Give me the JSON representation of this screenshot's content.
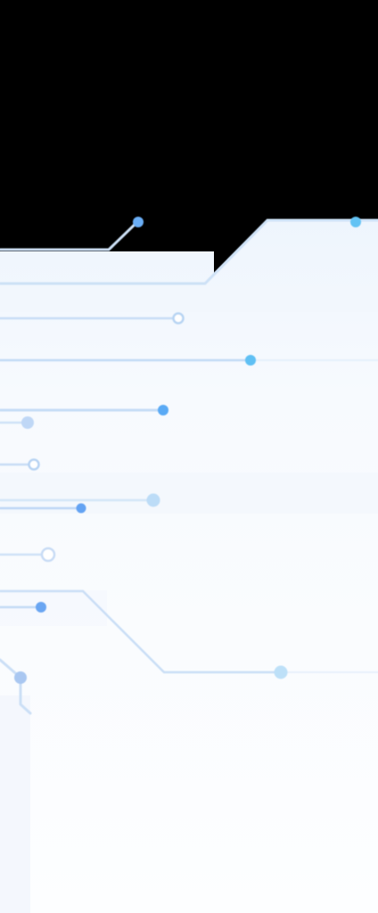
{
  "colors": {
    "backdrop": "#000000",
    "panel": "#f6f9fe",
    "panel_tint": "#eef6fd",
    "trace": "#cfe2f7",
    "trace_strong": "#b9d6f4",
    "node_blue": "#60a5fa",
    "node_cyan": "#60c7f5",
    "node_light": "#bcd6f6",
    "node_ring": "#c9dcf5"
  },
  "icons": [
    "circuit-trace-graphic",
    "circuit-node-icon"
  ]
}
